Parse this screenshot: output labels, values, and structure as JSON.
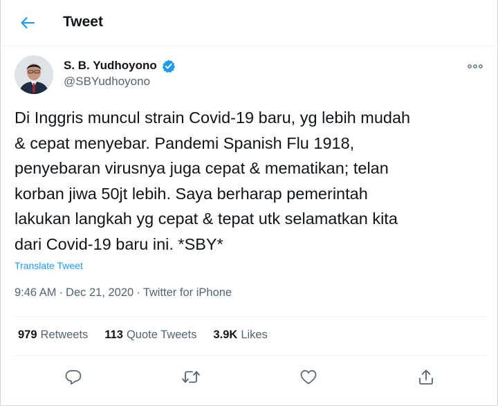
{
  "header": {
    "title": "Tweet",
    "back_icon": "arrow-left-icon"
  },
  "colors": {
    "accent": "#1d9bf0",
    "text": "#0f1419",
    "muted": "#536471",
    "divider": "#eff3f4"
  },
  "author": {
    "name": "S. B. Yudhoyono",
    "handle": "@SBYudhoyono",
    "verified": true
  },
  "tweet": {
    "text": "Di Inggris muncul strain Covid-19 baru, yg lebih mudah\n& cepat menyebar. Pandemi Spanish Flu 1918,\npenyebaran virusnya juga cepat & mematikan; telan\nkorban jiwa 50jt lebih. Saya berharap pemerintah\nlakukan langkah yg cepat & tepat utk selamatkan kita\ndari Covid-19 baru ini. *SBY*",
    "translate_label": "Translate Tweet",
    "time": "9:46 AM",
    "date": "Dec 21, 2020",
    "source": "Twitter for iPhone",
    "separator": "·"
  },
  "stats": [
    {
      "count": "979",
      "label": "Retweets"
    },
    {
      "count": "113",
      "label": "Quote Tweets"
    },
    {
      "count": "3.9K",
      "label": "Likes"
    }
  ],
  "actions": [
    {
      "name": "reply",
      "icon": "reply-icon"
    },
    {
      "name": "retweet",
      "icon": "retweet-icon"
    },
    {
      "name": "like",
      "icon": "heart-icon"
    },
    {
      "name": "share",
      "icon": "share-icon"
    }
  ]
}
